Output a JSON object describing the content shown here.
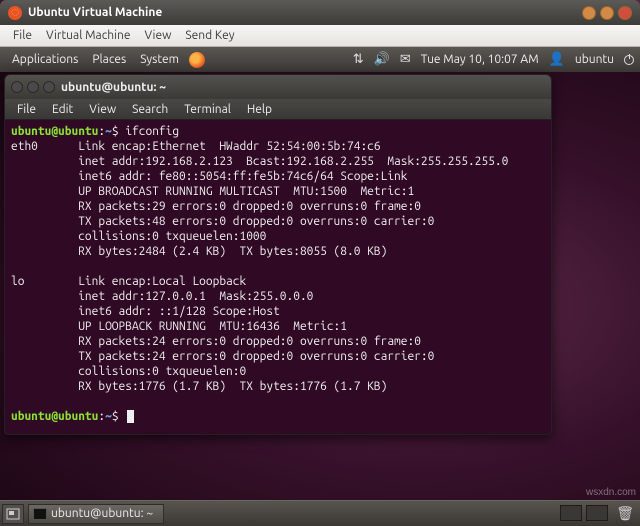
{
  "vm": {
    "title": "Ubuntu Virtual Machine",
    "menu": {
      "file": "File",
      "virtual_machine": "Virtual Machine",
      "view": "View",
      "send_key": "Send Key"
    }
  },
  "gnome": {
    "menus": {
      "applications": "Applications",
      "places": "Places",
      "system": "System"
    },
    "clock": "Tue May 10, 10:07 AM",
    "user": "ubuntu"
  },
  "terminal": {
    "title": "ubuntu@ubuntu: ~",
    "menu": {
      "file": "File",
      "edit": "Edit",
      "view": "View",
      "search": "Search",
      "terminal": "Terminal",
      "help": "Help"
    },
    "prompt": {
      "userhost": "ubuntu@ubuntu",
      "path": "~",
      "sep": ":",
      "sigil": "$"
    },
    "command": "ifconfig",
    "output_lines": [
      "eth0      Link encap:Ethernet  HWaddr 52:54:00:5b:74:c6",
      "          inet addr:192.168.2.123  Bcast:192.168.2.255  Mask:255.255.255.0",
      "          inet6 addr: fe80::5054:ff:fe5b:74c6/64 Scope:Link",
      "          UP BROADCAST RUNNING MULTICAST  MTU:1500  Metric:1",
      "          RX packets:29 errors:0 dropped:0 overruns:0 frame:0",
      "          TX packets:48 errors:0 dropped:0 overruns:0 carrier:0",
      "          collisions:0 txqueuelen:1000",
      "          RX bytes:2484 (2.4 KB)  TX bytes:8055 (8.0 KB)",
      "",
      "lo        Link encap:Local Loopback",
      "          inet addr:127.0.0.1  Mask:255.0.0.0",
      "          inet6 addr: ::1/128 Scope:Host",
      "          UP LOOPBACK RUNNING  MTU:16436  Metric:1",
      "          RX packets:24 errors:0 dropped:0 overruns:0 frame:0",
      "          TX packets:24 errors:0 dropped:0 overruns:0 carrier:0",
      "          collisions:0 txqueuelen:0",
      "          RX bytes:1776 (1.7 KB)  TX bytes:1776 (1.7 KB)",
      ""
    ]
  },
  "bottom": {
    "taskbar_item": "ubuntu@ubuntu: ~"
  },
  "watermark": "wsxdn.com"
}
